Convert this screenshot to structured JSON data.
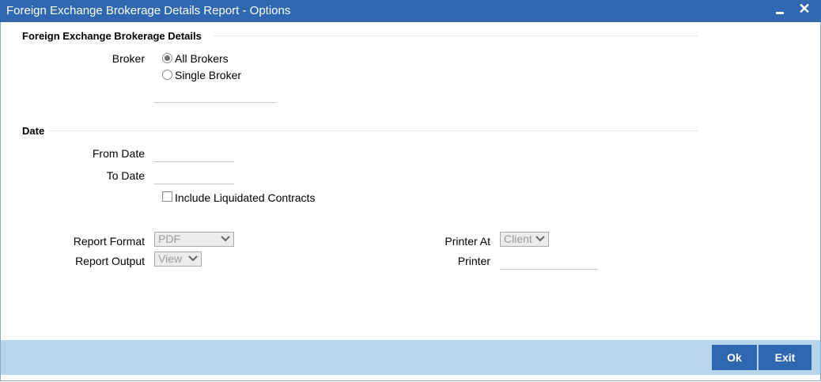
{
  "window": {
    "title": "Foreign Exchange Brokerage Details Report - Options",
    "minimize_icon": "minimize-icon",
    "close_icon": "close-icon",
    "close_glyph": "✕"
  },
  "brokerage": {
    "section_title": "Foreign Exchange Brokerage Details",
    "broker_label": "Broker",
    "options": [
      {
        "label": "All Brokers",
        "selected": true
      },
      {
        "label": "Single Broker",
        "selected": false
      }
    ],
    "broker_value": ""
  },
  "date": {
    "section_title": "Date",
    "from_label": "From Date",
    "from_value": "",
    "to_label": "To Date",
    "to_value": "",
    "include_liquidated_label": "Include Liquidated Contracts",
    "include_liquidated_checked": false
  },
  "report": {
    "format_label": "Report Format",
    "format_value": "PDF",
    "output_label": "Report Output",
    "output_value": "View",
    "printer_at_label": "Printer At",
    "printer_at_value": "Client",
    "printer_label": "Printer",
    "printer_value": ""
  },
  "footer": {
    "ok_label": "Ok",
    "exit_label": "Exit"
  },
  "colors": {
    "titlebar": "#2f67b0",
    "footer": "#b9d5ec",
    "button": "#2f67b0"
  }
}
